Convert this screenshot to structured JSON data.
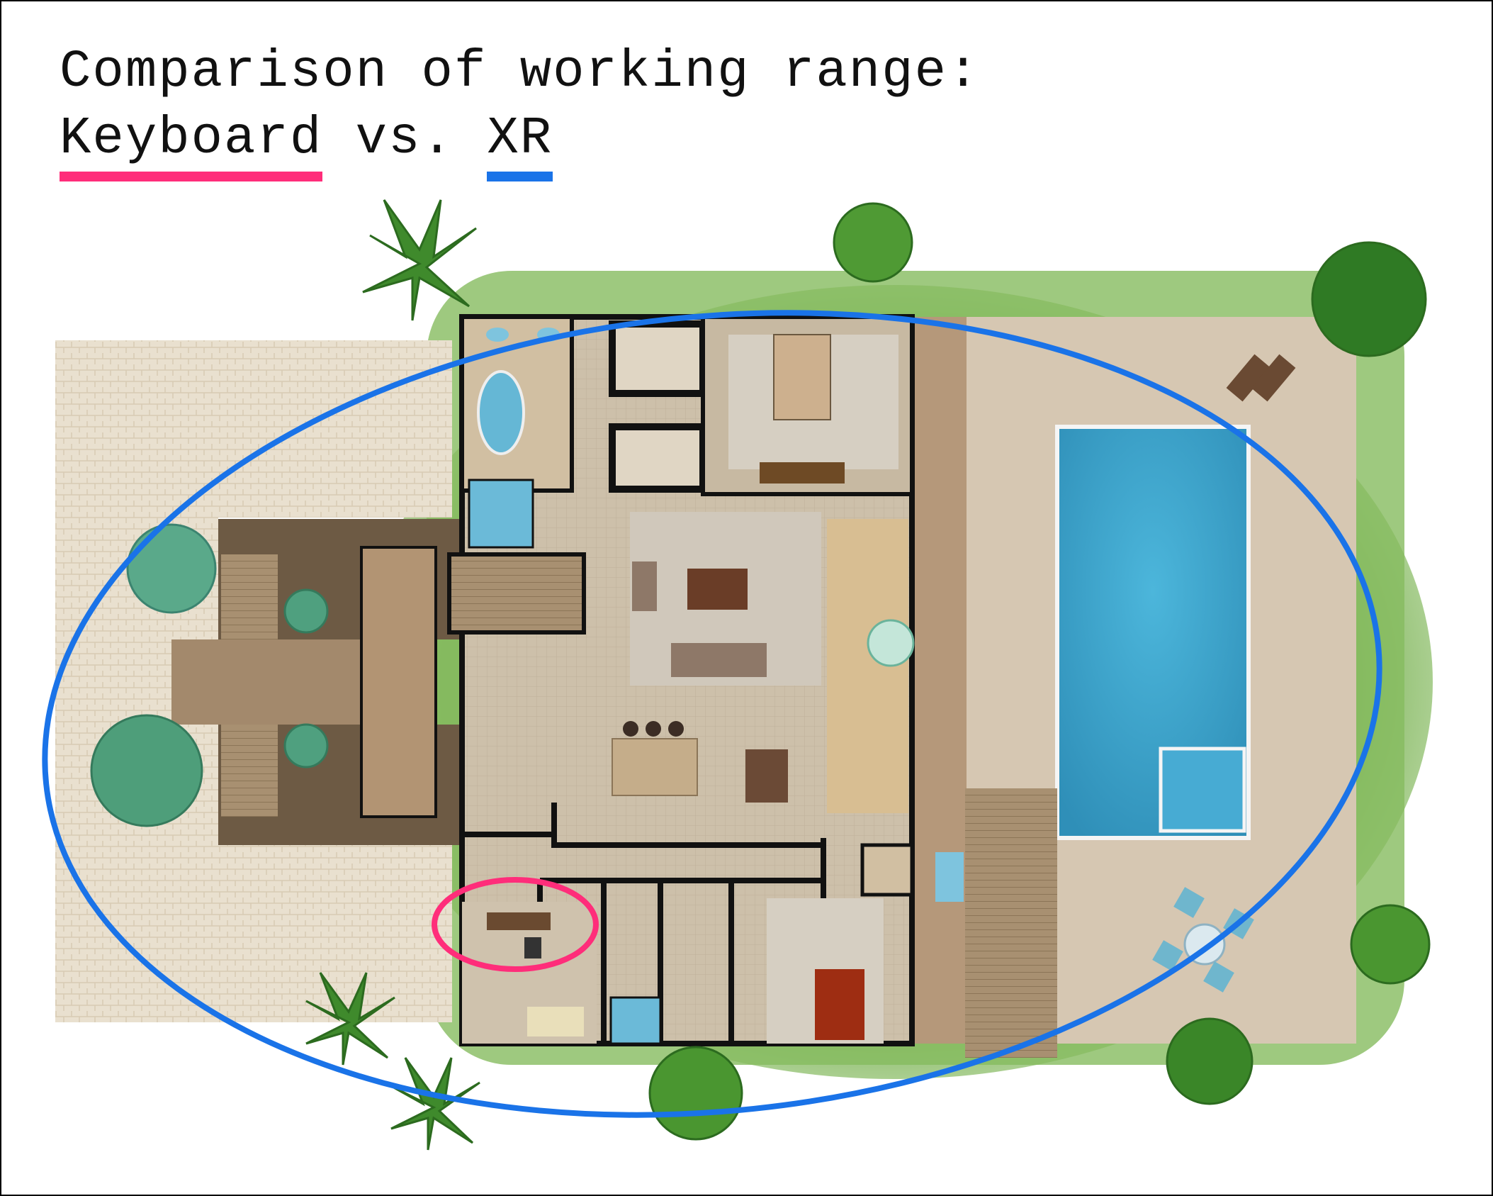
{
  "title": {
    "line1": "Comparison of working range:",
    "keyboard": "Keyboard",
    "vs": " vs. ",
    "xr": "XR"
  },
  "colors": {
    "keyboard": "#ff2d7a",
    "xr": "#1a73e8",
    "grass": "#7fb65a",
    "deck": "#c8b49a",
    "pool": "#3a9fc8",
    "pavers": "#e6dccb",
    "floor": "#cfc2ad",
    "walls": "#111111"
  },
  "icons": [
    "palm-tree-icon",
    "shrub-icon",
    "bed-icon",
    "sofa-icon",
    "desk-icon",
    "office-chair-icon",
    "table-icon",
    "bathtub-icon",
    "lounge-chair-icon"
  ]
}
